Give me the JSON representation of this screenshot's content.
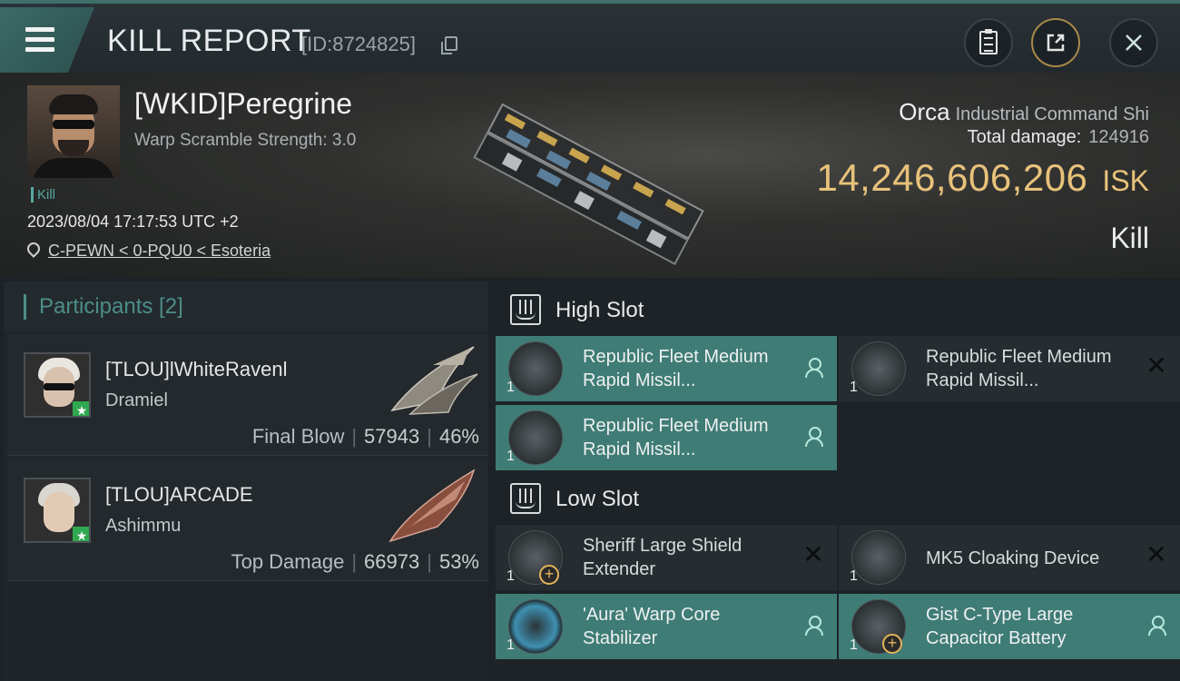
{
  "header": {
    "title": "KILL REPORT",
    "report_id": "[ID:8724825]"
  },
  "victim": {
    "name": "[WKID]Peregrine",
    "warp_scramble": "Warp Scramble Strength: 3.0",
    "tag": "Kill",
    "datetime": "2023/08/04 17:17:53 UTC +2",
    "location": "C-PEWN < 0-PQU0 < Esoteria"
  },
  "ship": {
    "name": "Orca",
    "class": "Industrial Command Shi",
    "total_damage_label": "Total damage:",
    "total_damage": "124916",
    "isk_value": "14,246,606,206",
    "isk_unit": "ISK",
    "result": "Kill"
  },
  "participants": {
    "title": "Participants [2]",
    "items": [
      {
        "name": "[TLOU]lWhiteRavenl",
        "ship": "Dramiel",
        "role": "Final Blow",
        "damage": "57943",
        "percent": "46%"
      },
      {
        "name": "[TLOU]ARCADE",
        "ship": "Ashimmu",
        "role": "Top Damage",
        "damage": "66973",
        "percent": "53%"
      }
    ]
  },
  "slots": {
    "high": {
      "title": "High Slot",
      "modules": [
        {
          "name": "Republic Fleet Medium Rapid Missil...",
          "qty": "1",
          "status": "fitted"
        },
        {
          "name": "Republic Fleet Medium Rapid Missil...",
          "qty": "1",
          "status": "destroyed"
        },
        {
          "name": "Republic Fleet Medium Rapid Missil...",
          "qty": "1",
          "status": "fitted"
        }
      ]
    },
    "low": {
      "title": "Low Slot",
      "modules": [
        {
          "name": "Sheriff Large Shield Extender",
          "qty": "1",
          "status": "destroyed"
        },
        {
          "name": "MK5 Cloaking Device",
          "qty": "1",
          "status": "destroyed"
        },
        {
          "name": "'Aura' Warp Core Stabilizer",
          "qty": "1",
          "status": "fitted"
        },
        {
          "name": "Gist C-Type Large Capacitor Battery",
          "qty": "1",
          "status": "fitted"
        }
      ]
    }
  },
  "colors": {
    "accent_teal": "#3f7c75",
    "isk_gold": "#e8c27a",
    "star_green": "#2fa84f"
  }
}
